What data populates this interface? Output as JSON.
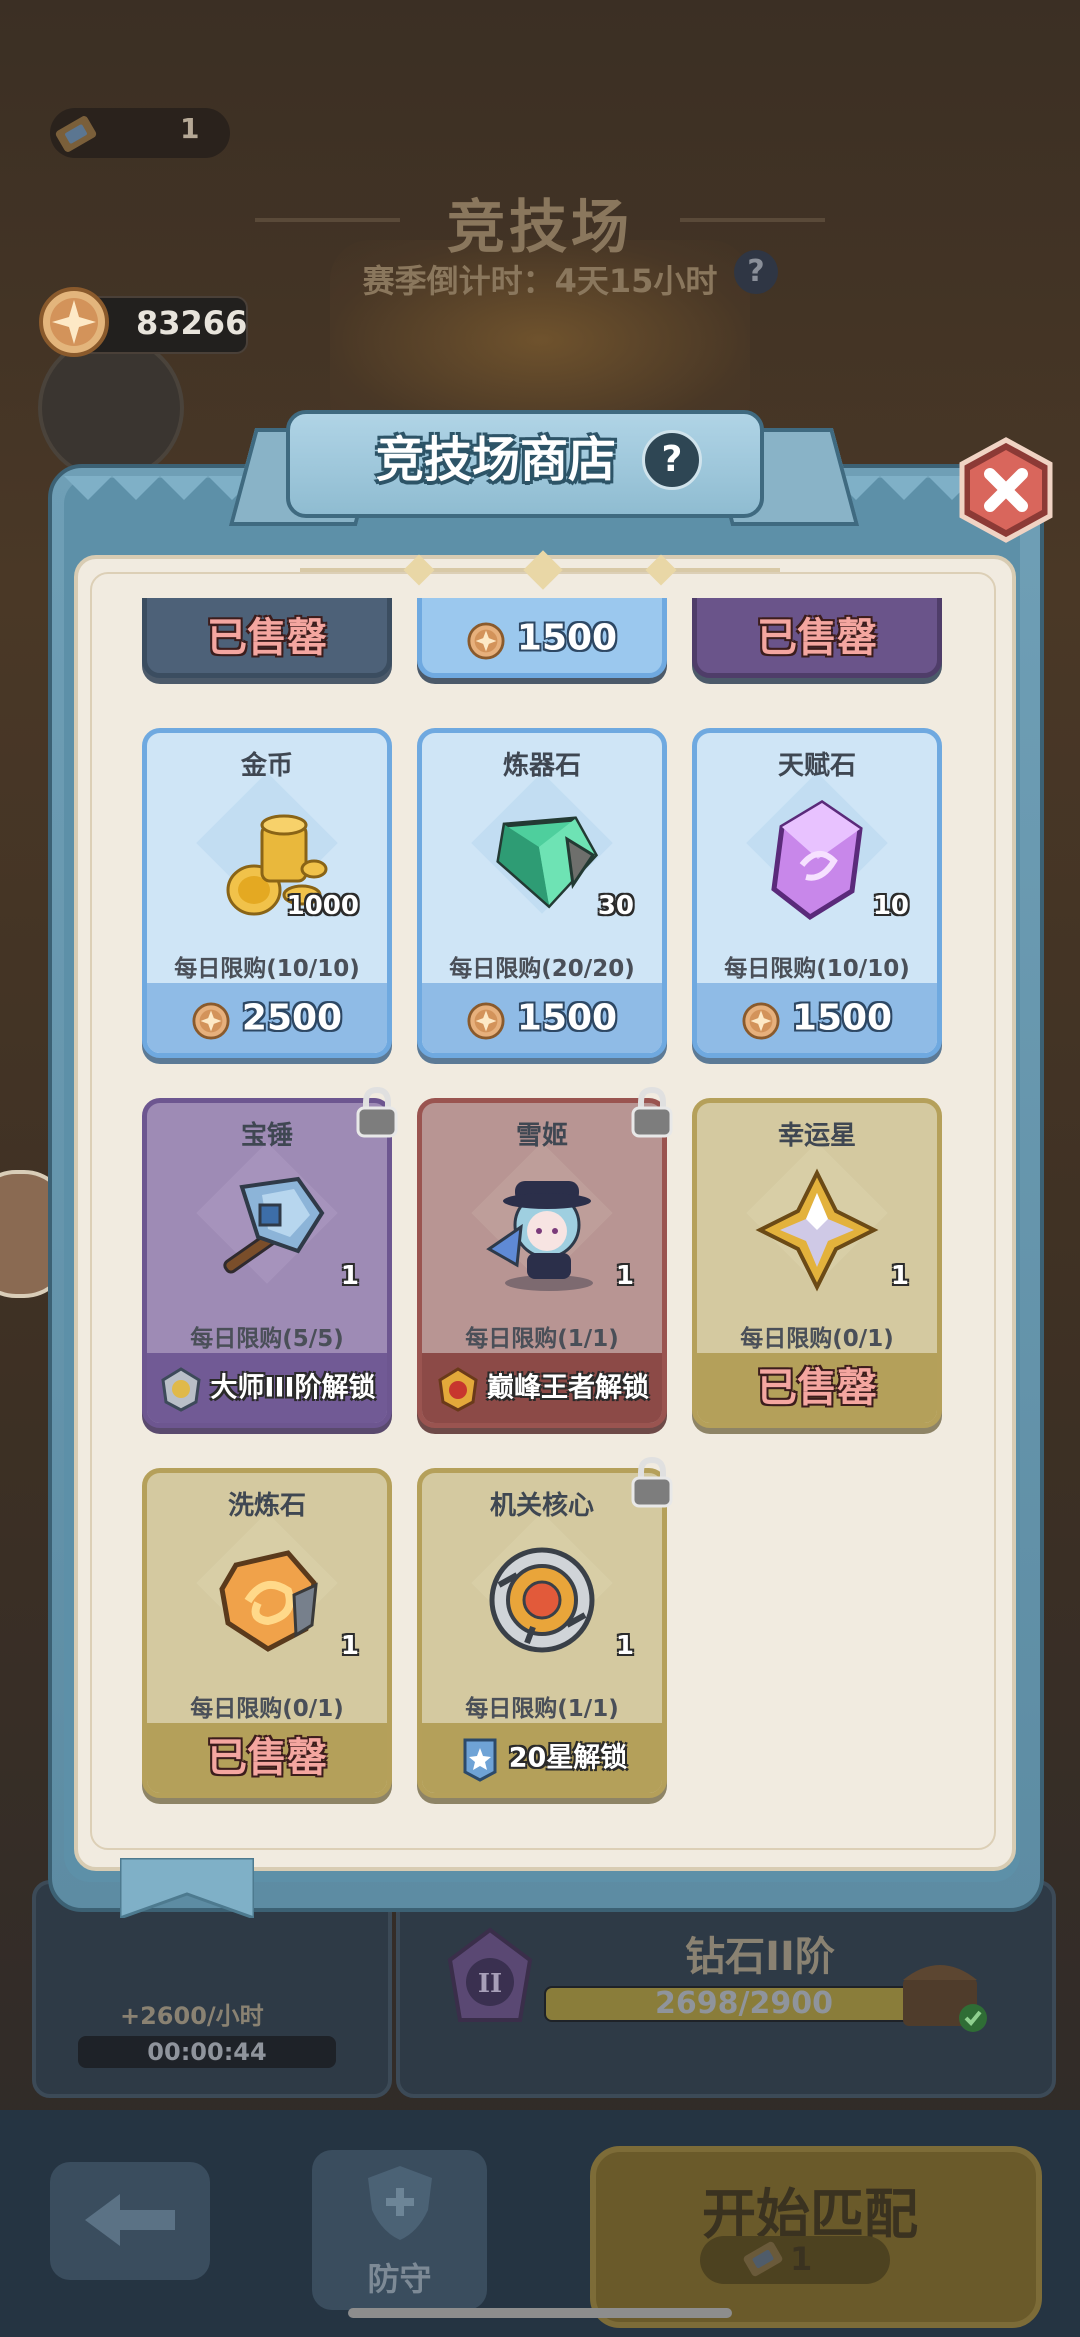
{
  "background": {
    "ticket_count": "1",
    "arena_title": "竞技场",
    "season_countdown": "赛季倒计时：4天15小时",
    "help_symbol": "?",
    "coin_amount": "83266",
    "idle_income_rate": "+2600/小时",
    "idle_timer": "00:00:44",
    "rank_name": "钻石II阶",
    "rank_progress": "2698/2900",
    "rank_progress_fraction": 0.93,
    "rank_emblem_numeral": "II",
    "back_button_icon": "arrow-left-icon",
    "defend_label": "防守",
    "match_label": "开始匹配",
    "match_ticket_cost": "1"
  },
  "shop": {
    "title": "竞技场商店",
    "help_symbol": "?",
    "close_icon": "close-x-icon"
  },
  "partial_row": [
    {
      "state": "soldout",
      "label": "已售罄",
      "theme": "slate"
    },
    {
      "state": "price",
      "price": "1500",
      "theme": "blue"
    },
    {
      "state": "soldout",
      "label": "已售罄",
      "theme": "purple"
    }
  ],
  "items": [
    {
      "name": "金币",
      "qty": "1000",
      "limit": "每日限购(10/10)",
      "price": "2500",
      "state": "price",
      "theme": "blue",
      "icon": "gold-coins-icon",
      "locked": false
    },
    {
      "name": "炼器石",
      "qty": "30",
      "limit": "每日限购(20/20)",
      "price": "1500",
      "state": "price",
      "theme": "blue",
      "icon": "refining-stone-icon",
      "locked": false
    },
    {
      "name": "天赋石",
      "qty": "10",
      "limit": "每日限购(10/10)",
      "price": "1500",
      "state": "price",
      "theme": "blue",
      "icon": "talent-stone-icon",
      "locked": false
    },
    {
      "name": "宝锤",
      "qty": "1",
      "limit": "每日限购(5/5)",
      "unlock": "大师III阶解锁",
      "state": "locked",
      "theme": "purple",
      "icon": "treasure-hammer-icon",
      "badge_icon": "master-rank-badge-icon",
      "locked": true
    },
    {
      "name": "雪姬",
      "qty": "1",
      "limit": "每日限购(1/1)",
      "unlock": "巅峰王者解锁",
      "state": "locked",
      "theme": "red",
      "icon": "snow-princess-icon",
      "badge_icon": "peak-king-badge-icon",
      "locked": true
    },
    {
      "name": "幸运星",
      "qty": "1",
      "limit": "每日限购(0/1)",
      "soldout": "已售罄",
      "state": "soldout",
      "theme": "olive",
      "icon": "lucky-star-icon",
      "locked": false
    },
    {
      "name": "洗炼石",
      "qty": "1",
      "limit": "每日限购(0/1)",
      "soldout": "已售罄",
      "state": "soldout",
      "theme": "olive",
      "icon": "reforge-stone-icon",
      "locked": false
    },
    {
      "name": "机关核心",
      "qty": "1",
      "limit": "每日限购(1/1)",
      "unlock": "20星解锁",
      "state": "locked",
      "theme": "olive",
      "icon": "mechanism-core-icon",
      "badge_icon": "star-flag-badge-icon",
      "locked": true
    }
  ]
}
